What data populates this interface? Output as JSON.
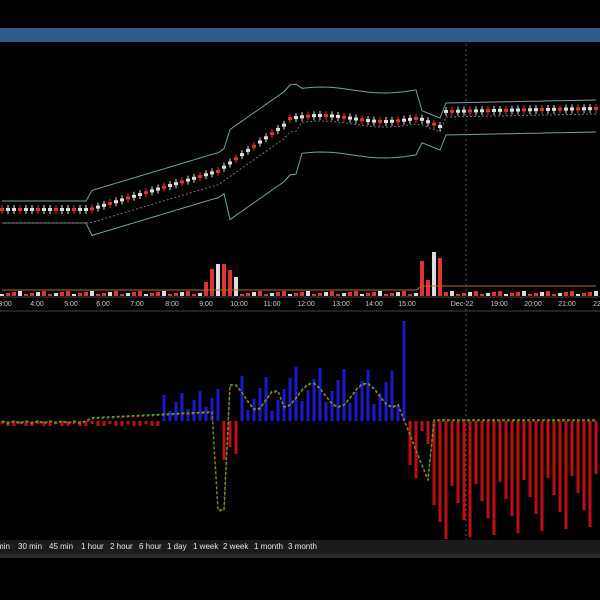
{
  "window": {
    "accent_color": "#2d5b8e"
  },
  "timeframes": [
    {
      "label": "min"
    },
    {
      "label": "30 min"
    },
    {
      "label": "45 min"
    },
    {
      "label": "1 hour"
    },
    {
      "label": "2 hour"
    },
    {
      "label": "6 hour"
    },
    {
      "label": "1 day"
    },
    {
      "label": "1 week"
    },
    {
      "label": "2 week"
    },
    {
      "label": "1 month"
    },
    {
      "label": "3 month"
    }
  ],
  "chart_data": {
    "type": "candlestick",
    "x_tick_labels": [
      "3:00",
      "4:00",
      "5:00",
      "6:00",
      "7:00",
      "8:00",
      "9:00",
      "10:00",
      "11:00",
      "12:00",
      "13:00",
      "14:00",
      "15:00",
      "Dec-22",
      "19:00",
      "20:00",
      "21:00",
      "22"
    ],
    "colors": {
      "up": "#dddddd",
      "down": "#dd3333",
      "bands": "#6fa3a3",
      "midline": "#777777",
      "hist_pos": "#1a1acc",
      "hist_neg": "#bb1111",
      "osc_up": "#33bb33",
      "osc_down": "#ee3333"
    },
    "indicators": [
      "bollinger_bands",
      "volume",
      "oscillator_histogram"
    ]
  }
}
